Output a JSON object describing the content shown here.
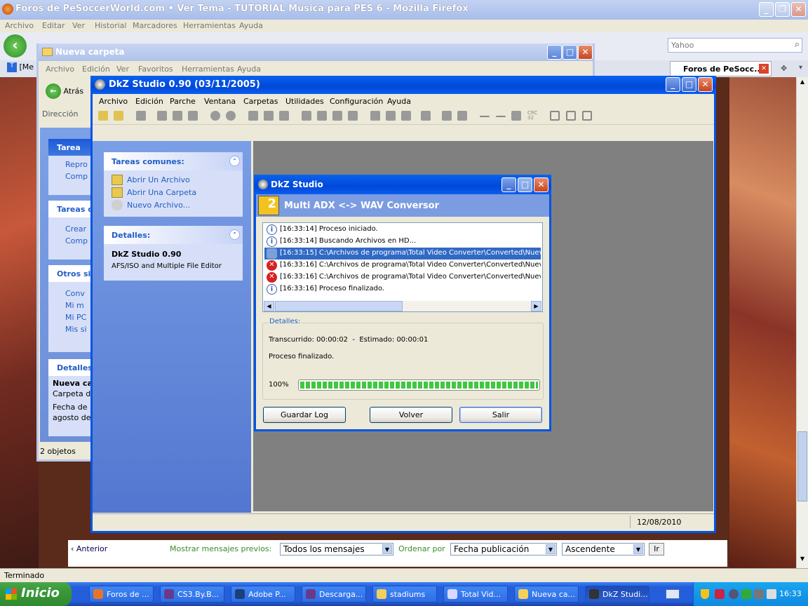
{
  "firefox": {
    "title": "Foros de PeSoccerWorld.com • Ver Tema - TUTORIAL Musica para PES 6 - Mozilla Firefox",
    "menu": [
      "Archivo",
      "Editar",
      "Ver",
      "Historial",
      "Marcadores",
      "Herramientas",
      "Ayuda"
    ],
    "search_placeholder": "Yahoo",
    "tab_partial": "[Me",
    "tab_active": "Foros de PeSocc...",
    "status": "Terminado",
    "prev_link": "Anterior",
    "show_prev_label": "Mostrar mensajes previos:",
    "show_prev_value": "Todos los mensajes",
    "order_label": "Ordenar por",
    "order_value": "Fecha publicación",
    "direction_value": "Ascendente",
    "go_button": "Ir"
  },
  "explorer": {
    "title": "Nueva carpeta",
    "menu": [
      "Archivo",
      "Edición",
      "Ver",
      "Favoritos",
      "Herramientas",
      "Ayuda"
    ],
    "back": "Atrás",
    "address_label": "Dirección",
    "panels": [
      {
        "title": "Tarea",
        "items": [
          "Repro",
          "Comp"
        ]
      },
      {
        "title": "Tareas d",
        "items": [
          "Crear",
          "Comp"
        ]
      },
      {
        "title": "Otros sit",
        "items": [
          "Conv",
          "Mi m",
          "Mi PC",
          "Mis si"
        ]
      },
      {
        "title": "Detalles",
        "items": [
          "Nueva ca",
          "Carpeta d",
          "Fecha de",
          "agosto de"
        ]
      }
    ],
    "status": "2 objetos"
  },
  "dkz": {
    "title": "DkZ Studio 0.90 (03/11/2005)",
    "menu": [
      "Archivo",
      "Edición",
      "Parche",
      "Ventana",
      "Carpetas",
      "Utilidades",
      "Configuración",
      "Ayuda"
    ],
    "tasks_title": "Tareas comunes:",
    "tasks": [
      "Abrir Un Archivo",
      "Abrir Una Carpeta",
      "Nuevo Archivo..."
    ],
    "details_title": "Detalles:",
    "details_name": "DkZ Studio 0.90",
    "details_desc": "AFS/ISO and Multiple File Editor",
    "status_date": "12/08/2010"
  },
  "dialog": {
    "title": "DkZ Studio",
    "header": "Multi ADX <-> WAV Conversor",
    "log": [
      {
        "type": "info",
        "time": "[16:33:14]",
        "text": "Proceso iniciado."
      },
      {
        "type": "info",
        "time": "[16:33:14]",
        "text": "Buscando Archivos en HD..."
      },
      {
        "type": "shield",
        "time": "[16:33:15]",
        "text": "C:\\Archivos de programa\\Total Video Converter\\Converted\\Nueva"
      },
      {
        "type": "error",
        "time": "[16:33:16]",
        "text": "C:\\Archivos de programa\\Total Video Converter\\Converted\\Nueva"
      },
      {
        "type": "error",
        "time": "[16:33:16]",
        "text": "C:\\Archivos de programa\\Total Video Converter\\Converted\\Nueva"
      },
      {
        "type": "info",
        "time": "[16:33:16]",
        "text": "Proceso finalizado."
      }
    ],
    "details_label": "Detalles:",
    "elapsed": "Transcurrido: 00:00:02  -  Estimado: 00:00:01",
    "status": "Proceso finalizado.",
    "progress_label": "100%",
    "progress": 1.0,
    "buttons": {
      "save": "Guardar Log",
      "back": "Volver",
      "exit": "Salir"
    }
  },
  "taskbar": {
    "start": "Inicio",
    "items": [
      {
        "label": "Foros de ...",
        "color": "#e8742a"
      },
      {
        "label": "CS3.By.B...",
        "color": "#6a3a8a"
      },
      {
        "label": "Adobe P...",
        "color": "#1d3f7a"
      },
      {
        "label": "Descarga...",
        "color": "#6a3a8a"
      },
      {
        "label": "stadiums",
        "color": "#f2d05a"
      },
      {
        "label": "Total Vid...",
        "color": "#d8d8ff"
      },
      {
        "label": "Nueva ca...",
        "color": "#f2d05a"
      },
      {
        "label": "DkZ Studi...",
        "color": "#333333"
      }
    ],
    "clock": "16:33"
  }
}
